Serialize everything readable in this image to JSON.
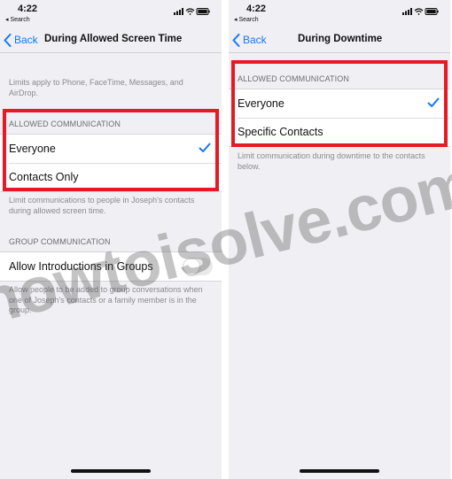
{
  "colors": {
    "accent": "#1478f5",
    "highlight": "#e51a25",
    "background": "#efeff4"
  },
  "left": {
    "status": {
      "time": "4:22",
      "back": "◂ Search"
    },
    "nav": {
      "back_label": "Back",
      "title": "During Allowed Screen Time"
    },
    "intro_note": "Limits apply to Phone, FaceTime, Messages, and AirDrop.",
    "allowed_communication": {
      "header": "ALLOWED COMMUNICATION",
      "options": [
        {
          "label": "Everyone",
          "selected": true
        },
        {
          "label": "Contacts Only",
          "selected": false
        }
      ],
      "footer": "Limit communications to people in Joseph's contacts during allowed screen time."
    },
    "group_communication": {
      "header": "GROUP COMMUNICATION",
      "toggle_label": "Allow Introductions in Groups",
      "toggle_on": false,
      "footer": "Allow people to be added to group conversations when one of Joseph's contacts or a family member is in the group."
    }
  },
  "right": {
    "status": {
      "time": "4:22",
      "back": "◂ Search"
    },
    "nav": {
      "back_label": "Back",
      "title": "During Downtime"
    },
    "allowed_communication": {
      "header": "ALLOWED COMMUNICATION",
      "options": [
        {
          "label": "Everyone",
          "selected": true
        },
        {
          "label": "Specific Contacts",
          "selected": false
        }
      ],
      "footer": "Limit communication during downtime to the contacts below."
    }
  },
  "watermark": "howtoisolve.com",
  "icons": [
    "signal-icon",
    "wifi-icon",
    "battery-icon",
    "chevron-left-icon",
    "checkmark-icon"
  ]
}
